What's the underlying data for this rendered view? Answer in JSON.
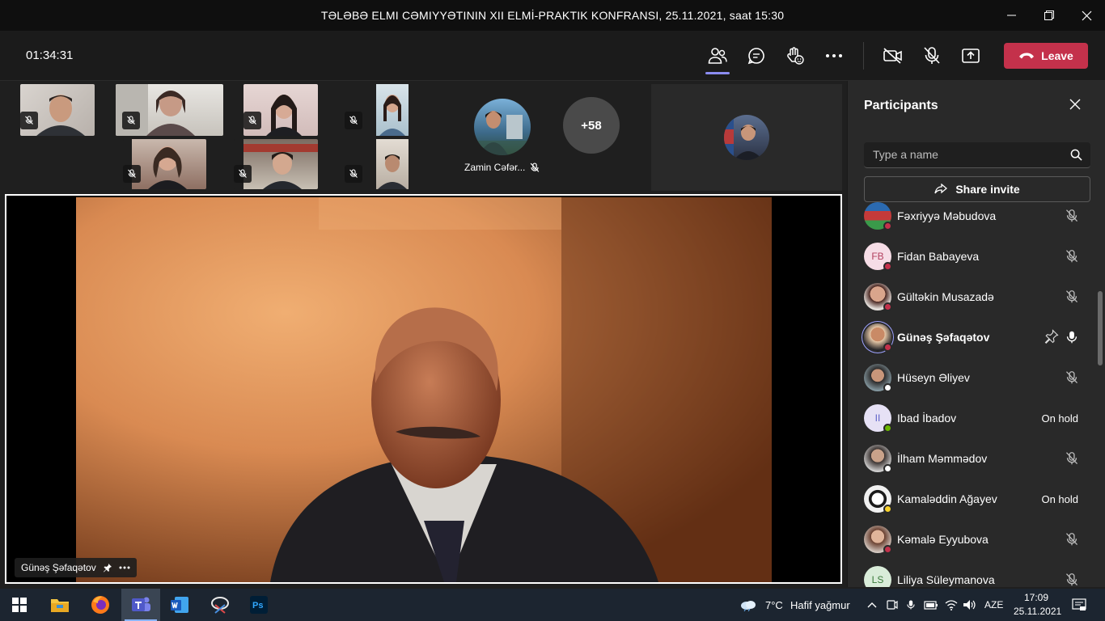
{
  "window": {
    "title": "TƏLƏBƏ ELMI CƏMIYYƏTININ XII ELMİ-PRAKTIK KONFRANSI, 25.11.2021, saat 15:30"
  },
  "toolbar": {
    "timer": "01:34:31",
    "leave_label": "Leave",
    "icons": [
      "people-icon",
      "chat-icon",
      "raise-hand-icon",
      "more-icon",
      "camera-off-icon",
      "mic-off-icon",
      "share-screen-icon"
    ]
  },
  "gallery": {
    "featured_name": "Zamin Cəfər...",
    "overflow_count": "+58"
  },
  "stage": {
    "speaker_name": "Günəş Şəfaqətov"
  },
  "panel": {
    "title": "Participants",
    "search_placeholder": "Type a name",
    "share_invite_label": "Share invite",
    "participants": [
      {
        "name": "Fəxriyyə Məbudova",
        "initials": "",
        "status": "mic-off",
        "right_text": ""
      },
      {
        "name": "Fidan Babayeva",
        "initials": "FB",
        "status": "mic-off",
        "right_text": ""
      },
      {
        "name": "Gültəkin Musazadə",
        "initials": "",
        "status": "mic-off",
        "right_text": ""
      },
      {
        "name": "Günəş Şəfaqətov",
        "initials": "",
        "status": "mic-on",
        "right_text": ""
      },
      {
        "name": "Hüseyn Əliyev",
        "initials": "",
        "status": "mic-off",
        "right_text": ""
      },
      {
        "name": "Ibad İbadov",
        "initials": "II",
        "status": "hold",
        "right_text": "On hold"
      },
      {
        "name": "İlham Məmmədov",
        "initials": "",
        "status": "mic-off",
        "right_text": ""
      },
      {
        "name": "Kamaləddin Ağayev",
        "initials": "",
        "status": "hold",
        "right_text": "On hold"
      },
      {
        "name": "Kəmalə Eyyubova",
        "initials": "",
        "status": "mic-off",
        "right_text": ""
      },
      {
        "name": "Liliya Süleymanova",
        "initials": "LS",
        "status": "mic-off",
        "right_text": ""
      }
    ]
  },
  "taskbar": {
    "weather_temp": "7°C",
    "weather_text": "Hafif yağmur",
    "language": "AZE",
    "time": "17:09",
    "date": "25.11.2021"
  },
  "colors": {
    "leave": "#c4314b",
    "accent": "#8b8cf0",
    "panel_bg": "#292929"
  }
}
